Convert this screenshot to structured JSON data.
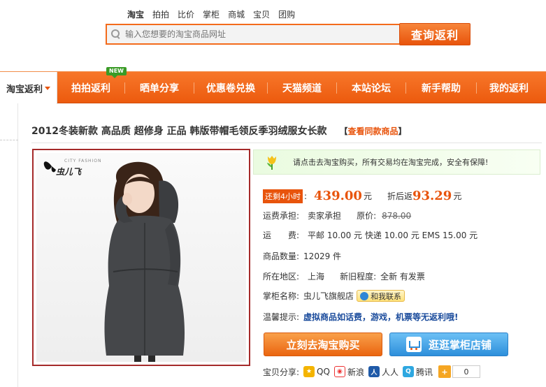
{
  "search": {
    "tabs": [
      "淘宝",
      "拍拍",
      "比价",
      "掌柜",
      "商城",
      "宝贝",
      "团购"
    ],
    "active_tab": "淘宝",
    "placeholder": "输入您想要的淘宝商品网址",
    "button": "查询返利"
  },
  "nav": {
    "home": "淘宝返利",
    "new_badge": "NEW",
    "items": [
      "拍拍返利",
      "晒单分享",
      "优惠卷兑换",
      "天猫频道",
      "本站论坛",
      "新手帮助",
      "我的返利"
    ]
  },
  "product": {
    "title": "2012冬装新款 高品质 超修身 正品 韩版带帽毛领反季羽绒服女长款",
    "same_link": "查看同款商品",
    "brand_tag": "CITY FASHION",
    "brand_name": "虫儿飞",
    "notice": "请点击去淘宝购买，所有交易均在淘宝完成，安全有保障!",
    "timer": "还剩4小时",
    "price": "439.00",
    "currency": "元",
    "rebate_label": "折后返",
    "rebate": "93.29",
    "shipping_label": "运费承担:",
    "shipping_value": "卖家承担",
    "original_label": "原价:",
    "original_price": "878.00",
    "freight_label": "运　　费:",
    "freight_value": "平邮 10.00 元 快递 10.00 元 EMS 15.00 元",
    "qty_label": "商品数量:",
    "qty_value": "12029 件",
    "location_label": "所在地区:",
    "location_value": "上海",
    "condition_label": "新旧程度:",
    "condition_value": "全新 有发票",
    "seller_label": "掌柜名称:",
    "seller_value": "虫儿飞旗舰店",
    "contact": "和我联系",
    "tip_label": "温馨提示:",
    "tip_value": "虚拟商品如话费，游戏，机票等无返利哦!",
    "buy_button": "立刻去淘宝购买",
    "shop_button": "逛逛掌柜店铺",
    "share_label": "宝贝分享:",
    "share_items": [
      "QQ",
      "新浪",
      "人人",
      "腾讯"
    ],
    "share_count": "0"
  },
  "colors": {
    "accent": "#e8540c",
    "nav_bg": "#f26a1f",
    "link_blue": "#1a4b9c",
    "notice_bg": "#eafbe0"
  }
}
